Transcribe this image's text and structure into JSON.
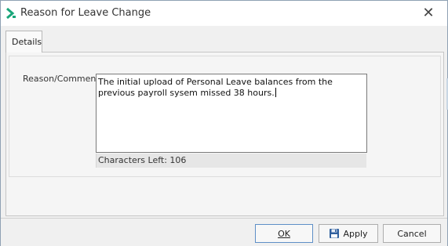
{
  "window": {
    "title": "Reason for Leave Change",
    "close_glyph": "✕"
  },
  "tabs": [
    {
      "label": "Details",
      "active": true
    }
  ],
  "form": {
    "reason_label": "Reason/Comment",
    "reason_text": "The initial upload of Personal Leave balances from the previous payroll sysem missed 38 hours.",
    "characters_left": "Characters Left: 106"
  },
  "buttons": {
    "ok": "OK",
    "apply": "Apply",
    "cancel": "Cancel"
  },
  "icons": {
    "app": "app-chevron-icon",
    "close": "close-icon",
    "apply": "floppy-disk-icon"
  },
  "colors": {
    "accent": "#1aa67a",
    "ok_border": "#5e8fc7"
  }
}
